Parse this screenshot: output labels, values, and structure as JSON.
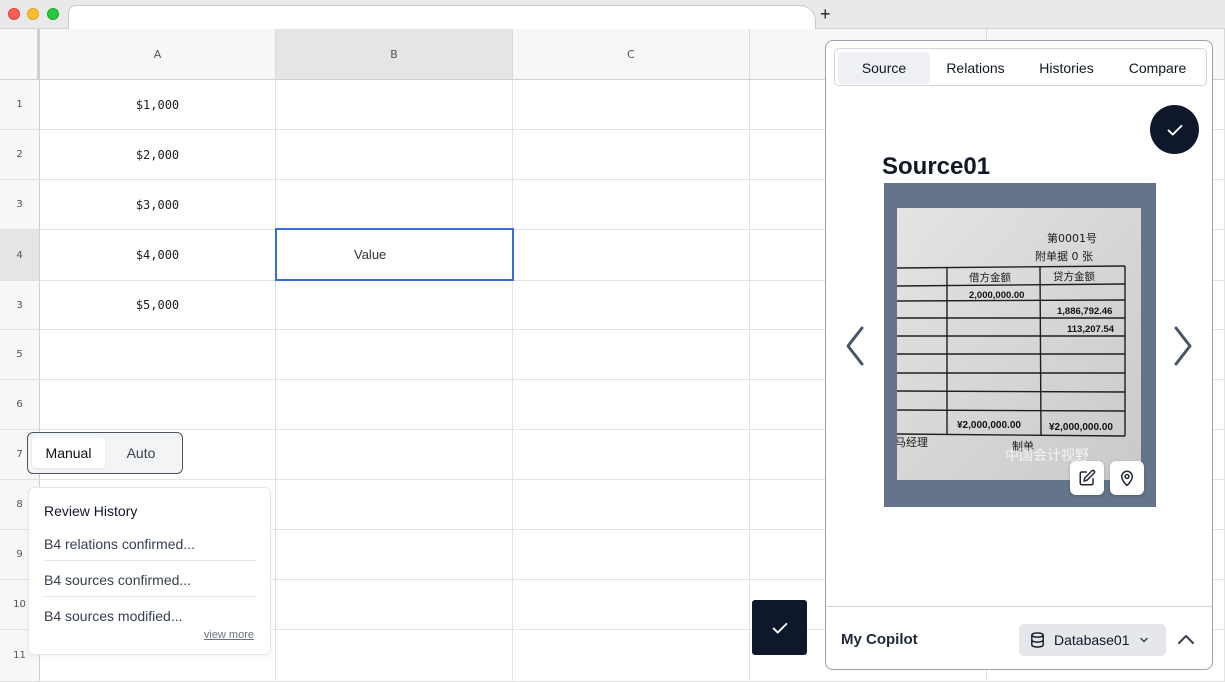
{
  "columns": [
    "A",
    "B",
    "C"
  ],
  "row_labels": [
    "1",
    "2",
    "3",
    "4",
    "3",
    "5",
    "6",
    "7",
    "8",
    "9",
    "10",
    "11"
  ],
  "cells": {
    "A1": "$1,000",
    "A2": "$2,000",
    "A3": "$3,000",
    "A4": "$4,000",
    "A5": "$5,000",
    "B4": "Value"
  },
  "mode_toggle": {
    "manual": "Manual",
    "auto": "Auto",
    "selected": "Manual"
  },
  "review_history": {
    "title": "Review History",
    "items": [
      "B4 relations confirmed...",
      "B4 sources confirmed...",
      "B4 sources modified..."
    ],
    "view_more": "view more"
  },
  "panel": {
    "tabs": [
      "Source",
      "Relations",
      "Histories",
      "Compare"
    ],
    "active_tab": "Source",
    "source_title": "Source01",
    "document": {
      "header_no": "第0001号",
      "attach": "附单据 0 张",
      "col_debit": "借方金额",
      "col_credit": "贷方金额",
      "debit_value": "2,000,000.00",
      "credit_1": "1,886,792.46",
      "credit_2": "113,207.54",
      "total_debit": "¥2,000,000.00",
      "total_credit": "¥2,000,000.00",
      "manager": "马经理",
      "preparer": "制单",
      "watermark": "中国会计视野"
    }
  },
  "copilot": {
    "title": "My Copilot",
    "database": "Database01"
  },
  "icons": {
    "panel_confirm": "check-icon",
    "float_confirm": "check-icon",
    "prev": "chevron-left-icon",
    "next": "chevron-right-icon",
    "edit": "edit-icon",
    "locate": "map-pin-icon",
    "database": "database-icon",
    "collapse": "chevron-up-icon"
  },
  "colors": {
    "dark_accent": "#0f172a",
    "selection_border": "#3b6fd4",
    "image_frame": "#64748b"
  }
}
